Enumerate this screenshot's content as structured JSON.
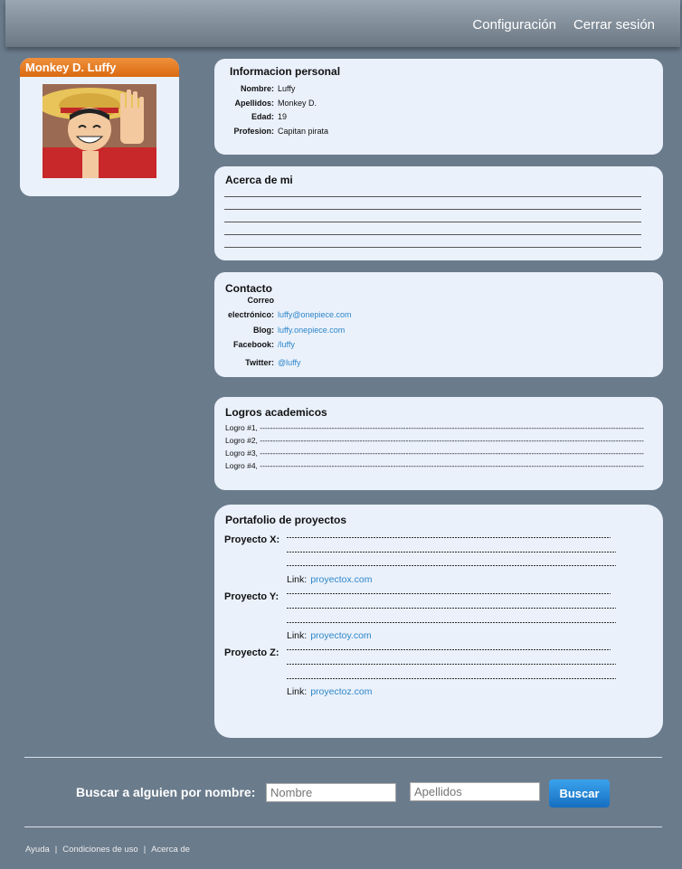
{
  "nav": {
    "config": "Configuración",
    "logout": "Cerrar sesión"
  },
  "profile": {
    "name": "Monkey D. Luffy"
  },
  "personal": {
    "title": "Informacion personal",
    "rows": [
      {
        "k": "Nombre:",
        "v": "Luffy"
      },
      {
        "k": "Apellidos:",
        "v": "Monkey D."
      },
      {
        "k": "Edad:",
        "v": "19"
      },
      {
        "k": "Profesion:",
        "v": "Capitan pirata"
      }
    ]
  },
  "about": {
    "title": "Acerca de mi"
  },
  "contact": {
    "title": "Contacto",
    "email_k1": "Correo",
    "email_k2": "electrónico:",
    "email": "luffy@onepiece.com",
    "blog_k": "Blog:",
    "blog": "luffy.onepiece.com",
    "fb_k": "Facebook:",
    "fb": "/luffy",
    "tw_k": "Twitter:",
    "tw": "@luffy"
  },
  "logros": {
    "title": "Logros academicos",
    "items": [
      "Logro #1, ------------------------------------------------------------------------------------------------------------------------------------------------------",
      "Logro #2, ------------------------------------------------------------------------------------------------------------------------------------------------------",
      "Logro #3, ------------------------------------------------------------------------------------------------------------------------------------------------------",
      "Logro #4, ------------------------------------------------------------------------------------------------------------------------------------------------------"
    ]
  },
  "portfolio": {
    "title": "Portafolio de proyectos",
    "link_label": "Link:",
    "projects": [
      {
        "name": "Proyecto X:",
        "link": "proyectox.com"
      },
      {
        "name": "Proyecto Y:",
        "link": "proyectoy.com"
      },
      {
        "name": "Proyecto Z:",
        "link": "proyectoz.com"
      }
    ]
  },
  "search": {
    "label": "Buscar a alguien por nombre:",
    "nombre_placeholder": "Nombre",
    "apellidos_placeholder": "Apellidos",
    "button": "Buscar"
  },
  "footer": {
    "help": "Ayuda",
    "terms": "Condiciones de uso",
    "about": "Acerca de",
    "sep": "|"
  }
}
